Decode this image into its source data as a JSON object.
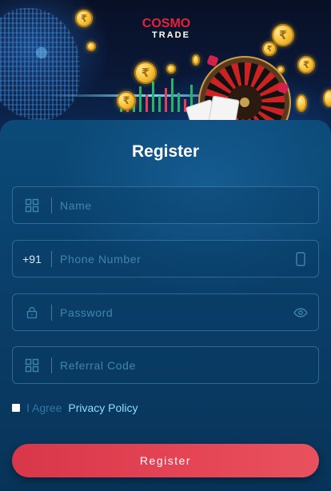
{
  "brand": {
    "logo_line1": "COSMO",
    "logo_line2": "TRADE",
    "coin_symbol": "₹"
  },
  "form": {
    "title": "Register",
    "name_placeholder": "Name",
    "phone_prefix": "+91",
    "phone_placeholder": "Phone Number",
    "password_placeholder": "Password",
    "referral_placeholder": "Referral Code",
    "agree_text": "I Agree",
    "privacy_link": "Privacy Policy",
    "submit_label": "Register"
  },
  "icons": {
    "name": "grid-icon",
    "phone": "mobile-phone-icon",
    "password": "lock-icon",
    "show_password": "eye-icon",
    "referral": "grid-icon"
  },
  "colors": {
    "accent_red": "#e54555",
    "link": "#8fdcff",
    "panel": "#0a3f6a"
  }
}
